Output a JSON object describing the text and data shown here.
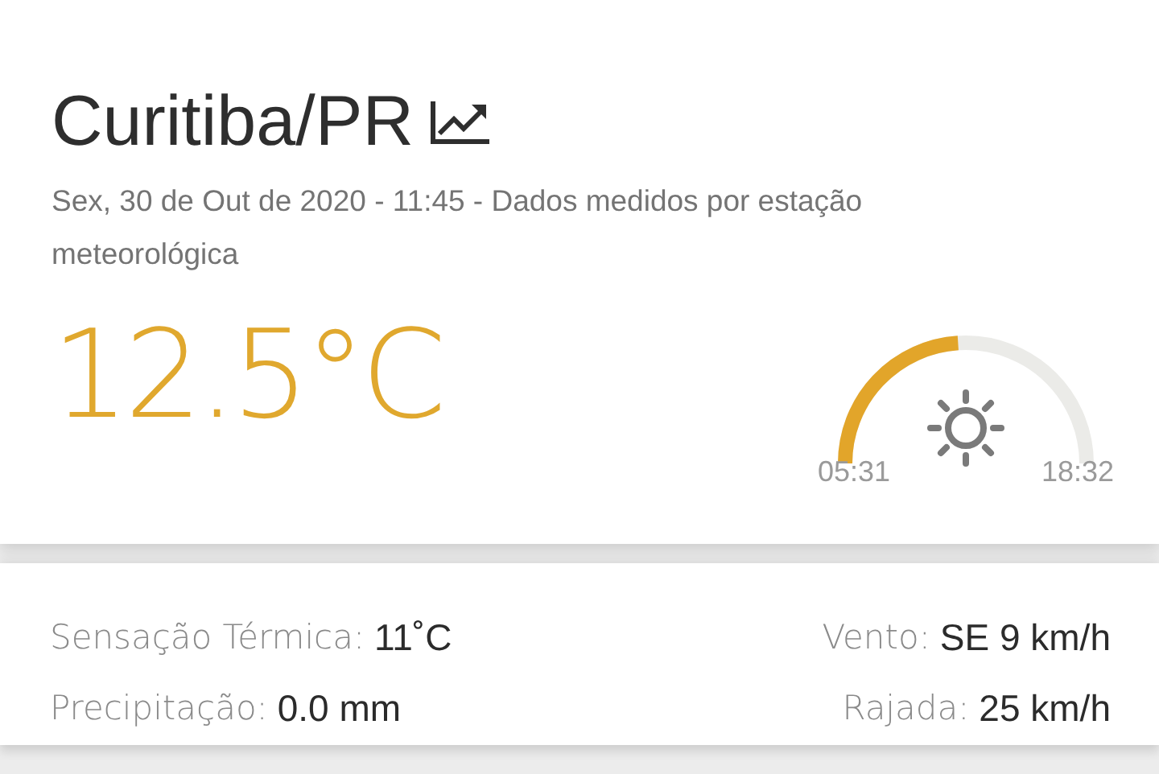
{
  "location": {
    "title": "Curitiba/PR",
    "subtitle": "Sex, 30 de Out de 2020 - 11:45 - Dados medidos por estação meteorológica"
  },
  "temperature": "12.5°C",
  "sun": {
    "sunrise": "05:31",
    "sunset": "18:32"
  },
  "stats_left": [
    {
      "label": "Sensação Térmica:",
      "value": "11˚C"
    },
    {
      "label": "Precipitação:",
      "value": "0.0 mm"
    }
  ],
  "stats_right": [
    {
      "label": "Vento:",
      "value": "SE 9 km/h"
    },
    {
      "label": "Rajada:",
      "value": "25 km/h"
    }
  ]
}
